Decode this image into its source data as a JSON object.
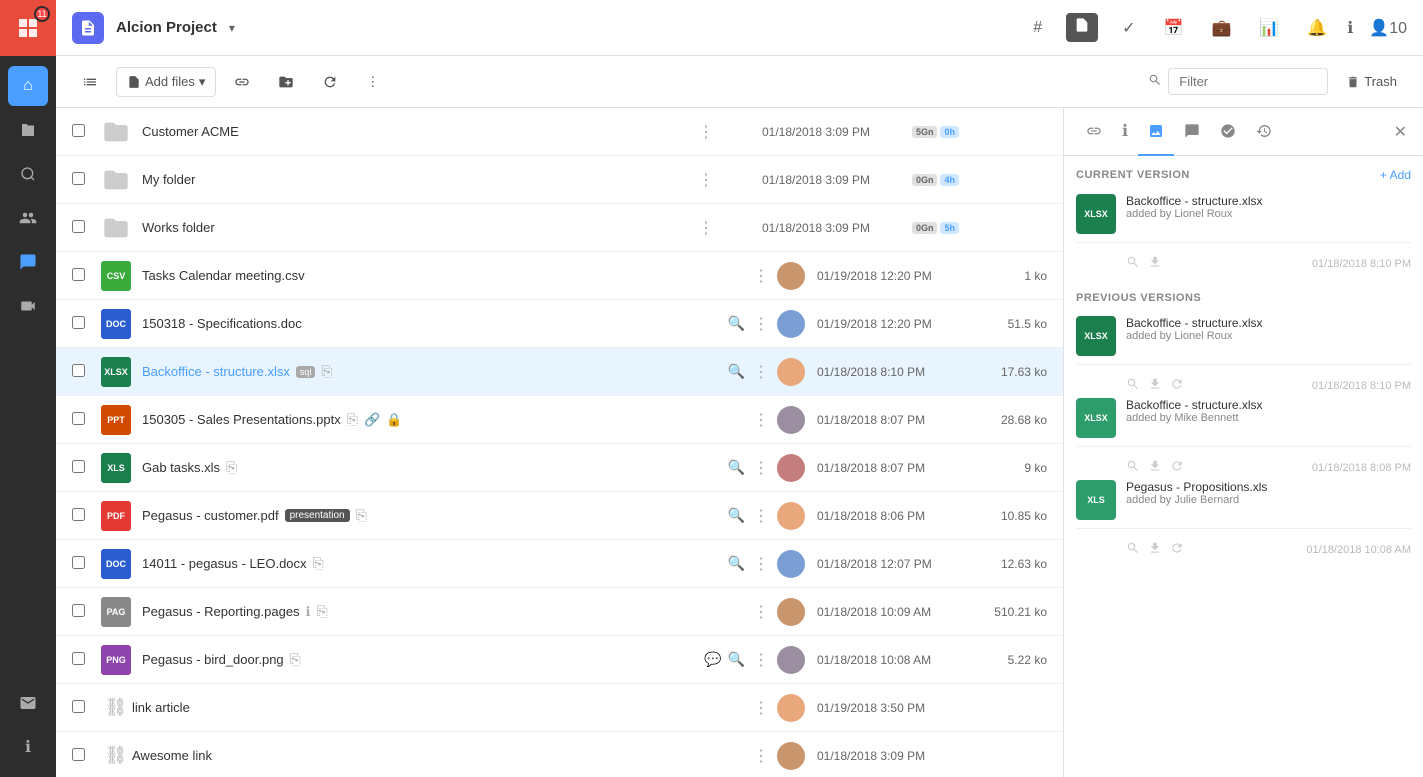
{
  "app": {
    "name": "Alcion Project",
    "badge": "11"
  },
  "topnav": {
    "title": "Alcion Project",
    "icons": [
      "#",
      "📄",
      "✓",
      "📅",
      "💼",
      "📊",
      "🔔"
    ],
    "right_icons": [
      "ℹ",
      "👤10"
    ]
  },
  "toolbar": {
    "add_files": "Add files",
    "trash": "Trash",
    "filter_placeholder": "Filter"
  },
  "files": [
    {
      "id": 1,
      "type": "folder",
      "name": "Customer ACME",
      "date": "01/18/2018 3:09 PM",
      "size": "",
      "badges": [
        "5Gn",
        "0h"
      ],
      "has_menu": true,
      "checked": false
    },
    {
      "id": 2,
      "type": "folder",
      "name": "My folder",
      "date": "01/18/2018 3:09 PM",
      "size": "",
      "badges": [
        "0Gn",
        "4h"
      ],
      "has_menu": true,
      "checked": false
    },
    {
      "id": 3,
      "type": "folder",
      "name": "Works folder",
      "date": "01/18/2018 3:09 PM",
      "size": "",
      "badges": [
        "0Gn",
        "5h"
      ],
      "has_menu": true,
      "checked": false
    },
    {
      "id": 4,
      "type": "csv",
      "name": "Tasks Calendar meeting.csv",
      "date": "01/19/2018 12:20 PM",
      "size": "1 ko",
      "avatar": "av1",
      "has_menu": true
    },
    {
      "id": 5,
      "type": "docx",
      "name": "150318 - Specifications.doc",
      "date": "01/19/2018 12:20 PM",
      "size": "51.5 ko",
      "avatar": "av2",
      "has_menu": true,
      "has_search": true
    },
    {
      "id": 6,
      "type": "xlsx",
      "name": "Backoffice - structure.xlsx",
      "date": "01/18/2018 8:10 PM",
      "size": "17.63 ko",
      "avatar": "av3",
      "has_menu": true,
      "has_search": true,
      "selected": true,
      "tags": [
        "sql"
      ],
      "has_copy": true,
      "linked": true
    },
    {
      "id": 7,
      "type": "pptx",
      "name": "150305 - Sales Presentations.pptx",
      "date": "01/18/2018 8:07 PM",
      "size": "28.68 ko",
      "avatar": "av4",
      "has_menu": true,
      "extra_icons": [
        "📋",
        "🔗",
        "🔒"
      ]
    },
    {
      "id": 8,
      "type": "xls",
      "name": "Gab tasks.xls",
      "date": "01/18/2018 8:07 PM",
      "size": "9 ko",
      "avatar": "av5",
      "has_menu": true,
      "has_search": true,
      "has_copy2": true
    },
    {
      "id": 9,
      "type": "pdf",
      "name": "Pegasus - customer.pdf",
      "date": "01/18/2018 8:06 PM",
      "size": "10.85 ko",
      "avatar": "av3",
      "has_menu": true,
      "has_search": true,
      "tag": "presentation",
      "has_copy3": true
    },
    {
      "id": 10,
      "type": "docx",
      "name": "14011 - pegasus - LEO.docx",
      "date": "01/18/2018 12:07 PM",
      "size": "12.63 ko",
      "avatar": "av2",
      "has_menu": true,
      "has_search": true,
      "has_copy4": true
    },
    {
      "id": 11,
      "type": "pag",
      "name": "Pegasus - Reporting.pages",
      "date": "01/18/2018 10:09 AM",
      "size": "510.21 ko",
      "avatar": "av1",
      "has_menu": true,
      "has_info": true,
      "has_copy5": true
    },
    {
      "id": 12,
      "type": "png",
      "name": "Pegasus - bird_door.png",
      "date": "01/18/2018 10:08 AM",
      "size": "5.22 ko",
      "avatar": "av4",
      "has_menu": true,
      "has_search": true,
      "has_copy6": true,
      "has_chat": true
    },
    {
      "id": 13,
      "type": "link",
      "name": "link article",
      "date": "01/19/2018 3:50 PM",
      "avatar": "av3",
      "has_menu": true,
      "checked": false
    },
    {
      "id": 14,
      "type": "link",
      "name": "Awesome link",
      "date": "01/18/2018 3:09 PM",
      "avatar": "av1",
      "has_menu": true
    }
  ],
  "right_panel": {
    "tabs": [
      {
        "id": "link",
        "icon": "🔗",
        "active": false
      },
      {
        "id": "info",
        "icon": "ℹ",
        "active": false
      },
      {
        "id": "versions",
        "icon": "🖼",
        "active": true
      },
      {
        "id": "comment",
        "icon": "💬",
        "active": false
      },
      {
        "id": "check",
        "icon": "✓",
        "active": false
      },
      {
        "id": "history",
        "icon": "↺",
        "active": false
      }
    ],
    "current_version_label": "CURRENT VERSION",
    "previous_versions_label": "PREVIOUS VERSIONS",
    "add_label": "+ Add",
    "versions": [
      {
        "id": "cv1",
        "type": "xlsx",
        "name": "Backoffice - structure.xlsx",
        "author": "added by Lionel Roux",
        "date": "01/18/2018 8:10 PM",
        "is_current": true
      },
      {
        "id": "pv1",
        "type": "xlsx",
        "name": "Backoffice - structure.xlsx",
        "author": "added by Lionel Roux",
        "date": "01/18/2018 8:10 PM",
        "is_current": false
      },
      {
        "id": "pv2",
        "type": "xlsx",
        "name": "Backoffice - structure.xlsx",
        "author": "added by Mike Bennett",
        "date": "01/18/2018 8:08 PM",
        "is_current": false
      },
      {
        "id": "pv3",
        "type": "xls",
        "name": "Pegasus - Propositions.xls",
        "author": "added by Julie Bernard",
        "date": "01/18/2018 10:08 AM",
        "is_current": false
      }
    ]
  }
}
